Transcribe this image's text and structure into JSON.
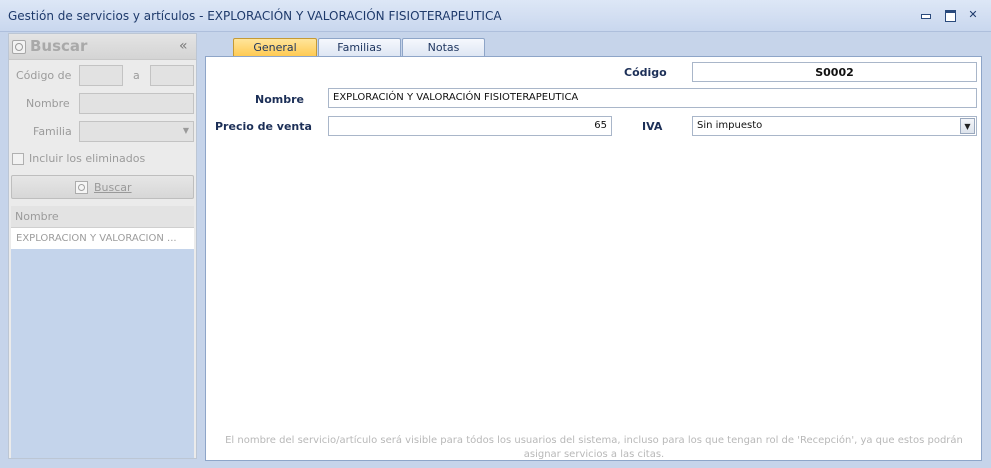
{
  "window": {
    "title": "Gestión de servicios y artículos - EXPLORACIÓN Y VALORACIÓN FISIOTERAPEUTICA"
  },
  "search_panel": {
    "title": "Buscar",
    "collapse_symbol": "«",
    "code_from_label": "Código de",
    "code_to_label": "a",
    "code_from_value": "",
    "code_to_value": "",
    "name_label": "Nombre",
    "name_value": "",
    "family_label": "Familia",
    "family_value": "",
    "include_deleted_label": "Incluir los eliminados",
    "search_button_label": "Buscar",
    "results": {
      "column_header": "Nombre",
      "rows": [
        "EXPLORACIÓN Y VALORACIÓN ..."
      ]
    }
  },
  "tabs": [
    {
      "label": "General",
      "active": true
    },
    {
      "label": "Familias",
      "active": false
    },
    {
      "label": "Notas",
      "active": false
    }
  ],
  "form": {
    "code_label": "Código",
    "code_value": "S0002",
    "name_label": "Nombre",
    "name_value": "EXPLORACIÓN Y VALORACIÓN FISIOTERAPEUTICA",
    "price_label": "Precio de venta",
    "price_value": "65",
    "iva_label": "IVA",
    "iva_value": "Sin impuesto",
    "footer_note": "El nombre del servicio/artículo será visible para tódos los usuarios del sistema, incluso para los que tengan rol de 'Recepción', ya que estos podrán asignar servicios a las citas."
  },
  "colors": {
    "active_tab": "#ffc94f",
    "window_background": "#c6d4ea",
    "title_text": "#1e3a6b"
  }
}
